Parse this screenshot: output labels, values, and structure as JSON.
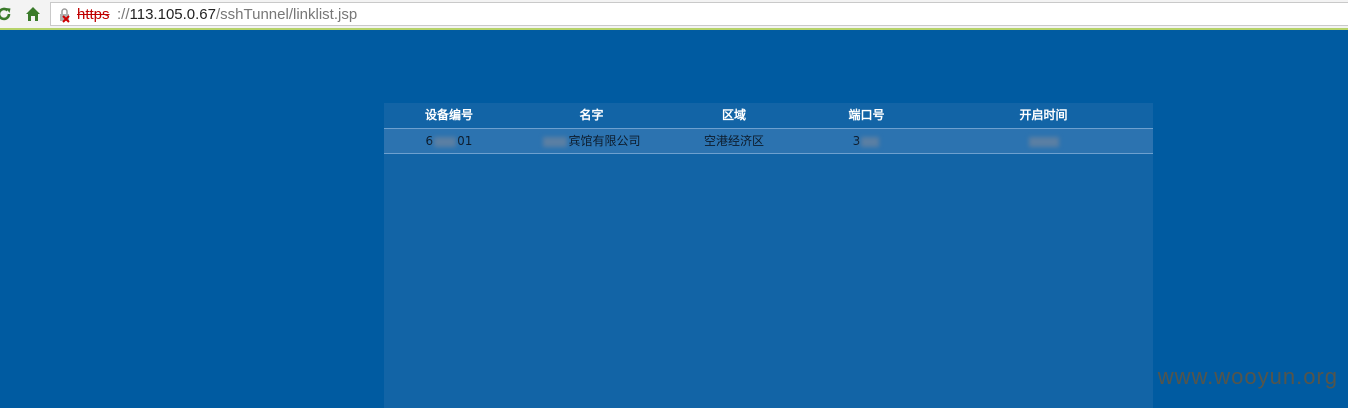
{
  "browser": {
    "url_scheme": "https",
    "url_separator": "://",
    "url_host": "113.105.0.67",
    "url_path": "/sshTunnel/linklist.jsp"
  },
  "table": {
    "headers": [
      "设备编号",
      "名字",
      "区域",
      "端口号",
      "开启时间"
    ],
    "rows": [
      {
        "device_prefix": "6",
        "device_suffix": "01",
        "name_suffix": "宾馆有限公司",
        "region": "空港经济区",
        "port_prefix": "3"
      }
    ]
  },
  "watermark": "www.wooyun.org",
  "colors": {
    "page_bg": "#005ba1",
    "panel_bg": "#1264a6",
    "row_bg": "#2c73b0",
    "insecure_scheme": "#c00000"
  }
}
